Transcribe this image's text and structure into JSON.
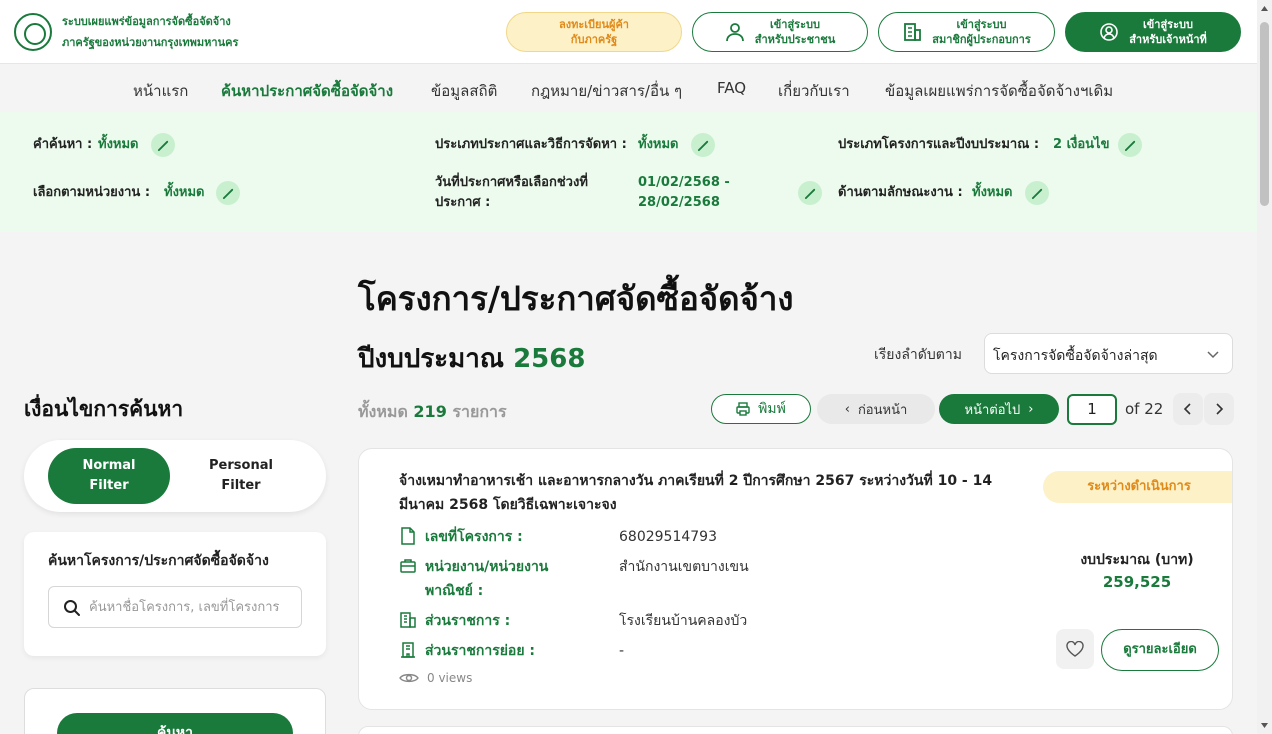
{
  "header": {
    "brand_line1": "ระบบเผยแพร่ข้อมูลการจัดซื้อจัดจ้าง",
    "brand_line2": "ภาครัฐของหน่วยงานกรุงเทพมหานคร",
    "register": {
      "line1": "ลงทะเบียนผู้ค้า",
      "line2": "กับภาครัฐ"
    },
    "citizen_login": {
      "line1": "เข้าสู่ระบบ",
      "line2": "สำหรับประชาชน"
    },
    "member_login": {
      "line1": "เข้าสู่ระบบ",
      "line2": "สมาชิกผู้ประกอบการ"
    },
    "officer_login": {
      "line1": "เข้าสู่ระบบ",
      "line2": "สำหรับเจ้าหน้าที่"
    }
  },
  "nav": {
    "items": [
      {
        "label": "หน้าแรก"
      },
      {
        "label": "ค้นหาประกาศจัดซื้อจัดจ้าง"
      },
      {
        "label": "ข้อมูลสถิติ"
      },
      {
        "label": "กฎหมาย/ข่าวสาร/อื่น ๆ"
      },
      {
        "label": "FAQ"
      },
      {
        "label": "เกี่ยวกับเรา"
      },
      {
        "label": "ข้อมูลเผยแพร่การจัดซื้อจัดจ้างฯเดิม"
      }
    ],
    "active_index": 1
  },
  "summary": {
    "keyword_label": "คำค้นหา :",
    "keyword_value": "ทั้งหมด",
    "announce_type_label": "ประเภทประกาศและวิธีการจัดหา :",
    "announce_type_value": "ทั้งหมด",
    "project_type_label": "ประเภทโครงการและปีงบประมาณ :",
    "project_type_value": "2 เงื่อนไข",
    "agency_label": "เลือกตามหน่วยงาน :",
    "agency_value": "ทั้งหมด",
    "date_label_line1": "วันที่ประกาศหรือเลือกช่วงที่",
    "date_label_line2": "ประกาศ :",
    "date_value_line1": "01/02/2568 -",
    "date_value_line2": "28/02/2568",
    "work_type_label": "ด้านตามลักษณะงาน :",
    "work_type_value": "ทั้งหมด"
  },
  "main": {
    "title": "โครงการ/ประกาศจัดซื้อจัดจ้าง",
    "year_label": "ปีงบประมาณ",
    "year_value": "2568",
    "sort_label": "เรียงลำดับตาม",
    "sort_value": "โครงการจัดซื้อจัดจ้างล่าสุด",
    "total_prefix": "ทั้งหมด",
    "total_count": "219",
    "total_suffix": "รายการ",
    "print_label": "พิมพ์",
    "prev_label": "ก่อนหน้า",
    "next_label": "หน้าต่อไป",
    "page_current": "1",
    "page_of": "of",
    "page_total": "22"
  },
  "sidebar": {
    "title": "เงื่อนไขการค้นหา",
    "normal_filter": {
      "line1": "Normal",
      "line2": "Filter"
    },
    "personal_filter": {
      "line1": "Personal",
      "line2": "Filter"
    },
    "search_title": "ค้นหาโครงการ/ประกาศจัดซื้อจัดจ้าง",
    "search_placeholder": "ค้นหาชื่อโครงการ, เลขที่โครงการ",
    "apply_label": "ค้นหา"
  },
  "result": {
    "title": "จ้างเหมาทำอาหารเช้า และอาหารกลางวัน ภาคเรียนที่ 2 ปีการศึกษา 2567 ระหว่างวันที่ 10 - 14 มีนาคม 2568 โดยวิธีเฉพาะเจาะจง",
    "status": "ระหว่างดำเนินการ",
    "project_no_label": "เลขที่โครงการ :",
    "project_no_value": "68029514793",
    "agency_label_line1": "หน่วยงาน/หน่วยงาน",
    "agency_label_line2": "พาณิชย์ :",
    "agency_value": "สำนักงานเขตบางเขน",
    "department_label": "ส่วนราชการ :",
    "department_value": "โรงเรียนบ้านคลองบัว",
    "subdept_label": "ส่วนราชการย่อย :",
    "subdept_value": "-",
    "views": "0 views",
    "budget_label": "งบประมาณ (บาท)",
    "budget_value": "259,525",
    "detail_label": "ดูรายละเอียด"
  },
  "colors": {
    "primary": "#1a7a3c",
    "warning_bg": "#fdf1c8",
    "warning_text": "#e08a1a",
    "summary_bg": "#edfbee"
  }
}
